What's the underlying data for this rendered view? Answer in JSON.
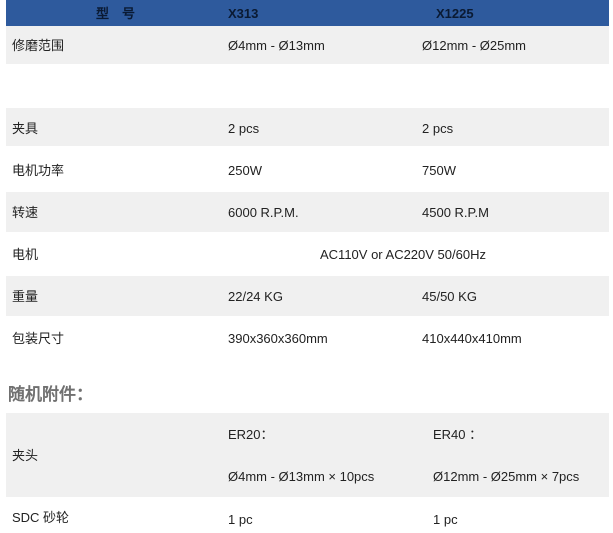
{
  "header": {
    "model_label": "型　号",
    "col1": "X313",
    "col2": "X1225"
  },
  "specs": {
    "range": {
      "label": "修磨范围",
      "v1": "Ø4mm - Ø13mm",
      "v2": "Ø12mm - Ø25mm"
    },
    "clamp": {
      "label": "夹具",
      "v1": "2 pcs",
      "v2": "2 pcs"
    },
    "power": {
      "label": "电机功率",
      "v1": "250W",
      "v2": "750W"
    },
    "speed": {
      "label": "转速",
      "v1": "6000 R.P.M.",
      "v2": "4500 R.P.M"
    },
    "motor": {
      "label": "电机",
      "value": "AC110V or AC220V 50/60Hz"
    },
    "weight": {
      "label": "重量",
      "v1": "22/24 KG",
      "v2": "45/50 KG"
    },
    "package": {
      "label": "包装尺寸",
      "v1": "390x360x360mm",
      "v2": "410x440x410mm"
    }
  },
  "accessories": {
    "title": "随机附件：",
    "collet": {
      "label": "夹头",
      "model1": "ER20：",
      "model2": "ER40 ：",
      "v1": "Ø4mm - Ø13mm × 10pcs",
      "v2": "Ø12mm - Ø25mm × 7pcs"
    },
    "wheel": {
      "label": "SDC 砂轮",
      "v1": "1 pc",
      "v2": "1 pc"
    }
  }
}
